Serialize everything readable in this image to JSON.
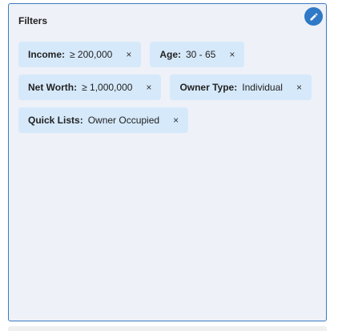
{
  "filters_panel": {
    "title": "Filters",
    "edit_icon": "pencil-icon",
    "chips": [
      {
        "label": "Income:",
        "value": "≥ 200,000",
        "remove": "×"
      },
      {
        "label": "Age:",
        "value": "30 - 65",
        "remove": "×"
      },
      {
        "label": "Net Worth:",
        "value": "≥ 1,000,000",
        "remove": "×"
      },
      {
        "label": "Owner Type:",
        "value": "Individual",
        "remove": "×"
      },
      {
        "label": "Quick Lists:",
        "value": "Owner Occupied",
        "remove": "×"
      }
    ]
  },
  "colors": {
    "accent": "#2f79c6",
    "panel_border": "#3b7bc4",
    "panel_background": "#eef1f8",
    "chip_background": "#d6e9fa"
  }
}
